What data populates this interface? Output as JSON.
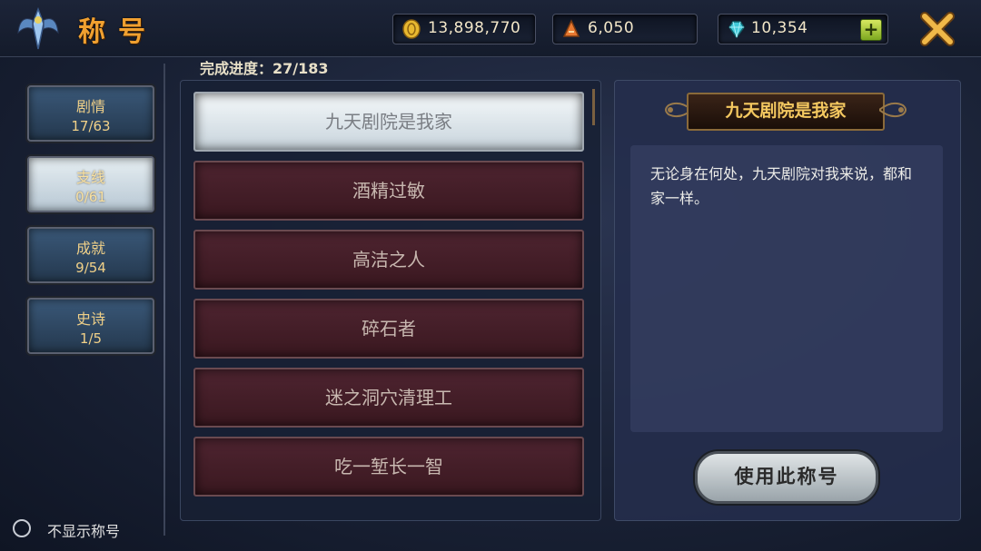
{
  "header": {
    "title": "称号",
    "currencies": [
      {
        "name": "gold",
        "value": "13,898,770",
        "icon": "gold-coin-icon"
      },
      {
        "name": "ticket",
        "value": "6,050",
        "icon": "ticket-icon"
      },
      {
        "name": "gem",
        "value": "10,354",
        "icon": "gem-icon"
      }
    ],
    "add_label": "+"
  },
  "tabs": [
    {
      "name": "剧情",
      "count": "17/63"
    },
    {
      "name": "支线",
      "count": "0/61"
    },
    {
      "name": "成就",
      "count": "9/54"
    },
    {
      "name": "史诗",
      "count": "1/5"
    }
  ],
  "active_tab": 1,
  "progress": "完成进度：27/183",
  "titles": [
    "九天剧院是我家",
    "酒精过敏",
    "高洁之人",
    "碎石者",
    "迷之洞穴清理工",
    "吃一堑长一智"
  ],
  "selected_title_index": 0,
  "detail": {
    "title": "九天剧院是我家",
    "description": "无论身在何处，九天剧院对我来说，都和家一样。",
    "use_button": "使用此称号"
  },
  "hide_title_label": "不显示称号",
  "colors": {
    "accent_gold": "#f0a030",
    "selected_item": "#f4f8fa",
    "list_item": "#4e2430"
  }
}
